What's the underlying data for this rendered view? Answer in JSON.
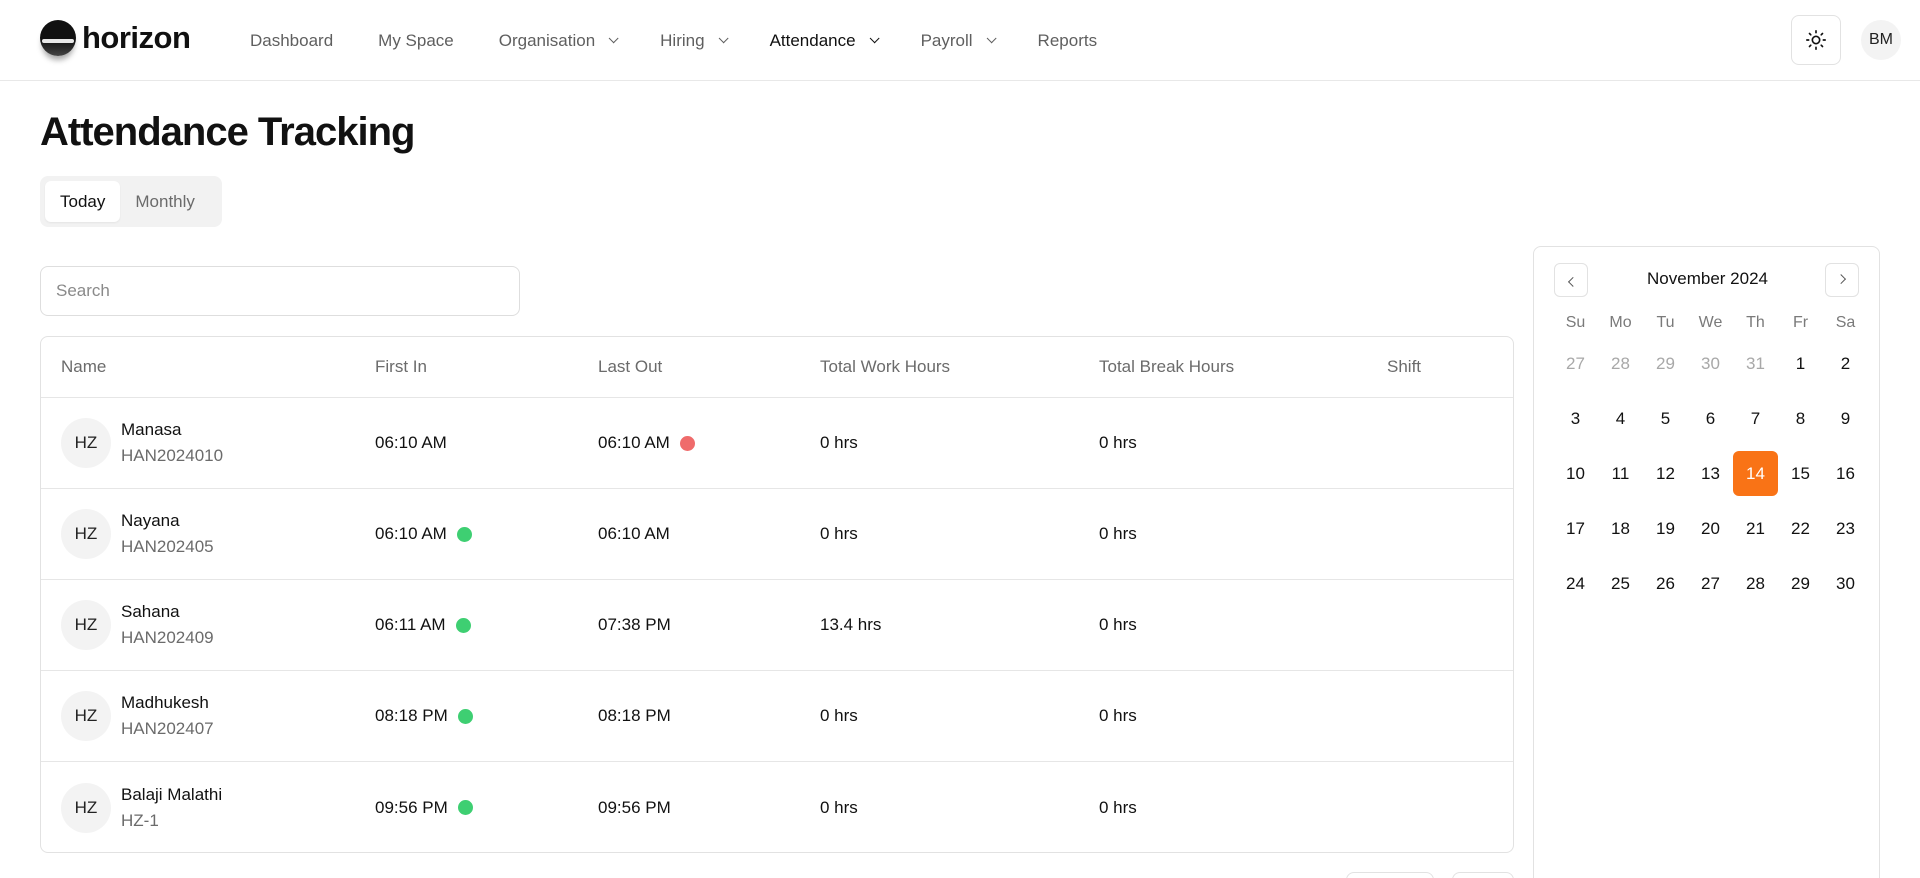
{
  "brand": {
    "name": "horizon"
  },
  "nav": {
    "items": [
      {
        "label": "Dashboard",
        "dropdown": false,
        "active": false
      },
      {
        "label": "My Space",
        "dropdown": false,
        "active": false
      },
      {
        "label": "Organisation",
        "dropdown": true,
        "active": false
      },
      {
        "label": "Hiring",
        "dropdown": true,
        "active": false
      },
      {
        "label": "Attendance",
        "dropdown": true,
        "active": true
      },
      {
        "label": "Payroll",
        "dropdown": true,
        "active": false
      },
      {
        "label": "Reports",
        "dropdown": false,
        "active": false
      }
    ],
    "theme_icon": "sun-icon",
    "user_initials": "BM"
  },
  "page": {
    "title": "Attendance Tracking",
    "tabs": [
      {
        "label": "Today",
        "active": true
      },
      {
        "label": "Monthly",
        "active": false
      }
    ],
    "search_placeholder": "Search"
  },
  "table": {
    "columns": [
      "Name",
      "First In",
      "Last Out",
      "Total Work Hours",
      "Total Break Hours",
      "Shift"
    ],
    "rows": [
      {
        "initials": "HZ",
        "name": "Manasa",
        "emp_id": "HAN2024010",
        "first_in": "06:10 AM",
        "first_in_status": null,
        "last_out": "06:10 AM",
        "last_out_status": "red",
        "work_hours": "0 hrs",
        "break_hours": "0 hrs",
        "shift": ""
      },
      {
        "initials": "HZ",
        "name": "Nayana",
        "emp_id": "HAN202405",
        "first_in": "06:10 AM",
        "first_in_status": "green",
        "last_out": "06:10 AM",
        "last_out_status": null,
        "work_hours": "0 hrs",
        "break_hours": "0 hrs",
        "shift": ""
      },
      {
        "initials": "HZ",
        "name": "Sahana",
        "emp_id": "HAN202409",
        "first_in": "06:11 AM",
        "first_in_status": "green",
        "last_out": "07:38 PM",
        "last_out_status": null,
        "work_hours": "13.4 hrs",
        "break_hours": "0 hrs",
        "shift": ""
      },
      {
        "initials": "HZ",
        "name": "Madhukesh",
        "emp_id": "HAN202407",
        "first_in": "08:18 PM",
        "first_in_status": "green",
        "last_out": "08:18 PM",
        "last_out_status": null,
        "work_hours": "0 hrs",
        "break_hours": "0 hrs",
        "shift": ""
      },
      {
        "initials": "HZ",
        "name": "Balaji Malathi",
        "emp_id": "HZ-1",
        "first_in": "09:56 PM",
        "first_in_status": "green",
        "last_out": "09:56 PM",
        "last_out_status": null,
        "work_hours": "0 hrs",
        "break_hours": "0 hrs",
        "shift": ""
      }
    ]
  },
  "calendar": {
    "month_label": "November 2024",
    "weekdays": [
      "Su",
      "Mo",
      "Tu",
      "We",
      "Th",
      "Fr",
      "Sa"
    ],
    "days": [
      {
        "d": "27",
        "muted": true
      },
      {
        "d": "28",
        "muted": true
      },
      {
        "d": "29",
        "muted": true
      },
      {
        "d": "30",
        "muted": true
      },
      {
        "d": "31",
        "muted": true
      },
      {
        "d": "1"
      },
      {
        "d": "2"
      },
      {
        "d": "3"
      },
      {
        "d": "4"
      },
      {
        "d": "5"
      },
      {
        "d": "6"
      },
      {
        "d": "7"
      },
      {
        "d": "8"
      },
      {
        "d": "9"
      },
      {
        "d": "10"
      },
      {
        "d": "11"
      },
      {
        "d": "12"
      },
      {
        "d": "13"
      },
      {
        "d": "14",
        "selected": true
      },
      {
        "d": "15"
      },
      {
        "d": "16"
      },
      {
        "d": "17"
      },
      {
        "d": "18"
      },
      {
        "d": "19"
      },
      {
        "d": "20"
      },
      {
        "d": "21"
      },
      {
        "d": "22"
      },
      {
        "d": "23"
      },
      {
        "d": "24"
      },
      {
        "d": "25"
      },
      {
        "d": "26"
      },
      {
        "d": "27"
      },
      {
        "d": "28"
      },
      {
        "d": "29"
      },
      {
        "d": "30"
      }
    ]
  },
  "colors": {
    "accent": "#f97316",
    "status_green": "#3ecf72",
    "status_red": "#ef6b6b",
    "border": "#e2e2e2",
    "muted_text": "#6b6b6b"
  }
}
